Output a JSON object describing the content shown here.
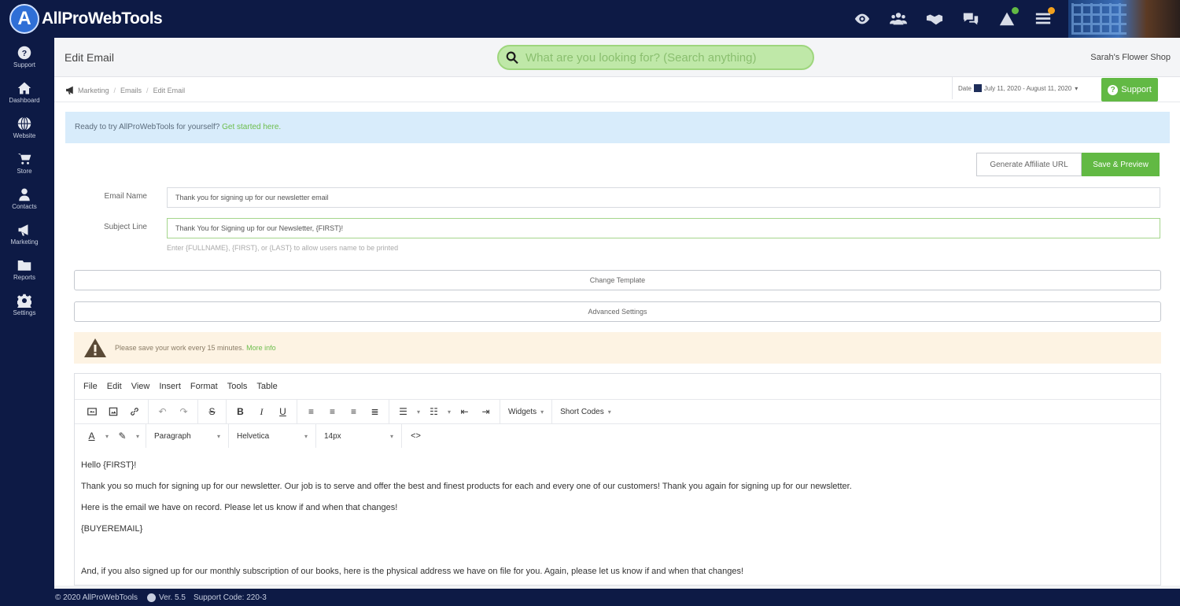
{
  "app": {
    "logo_letter": "A",
    "name": "AllProWebTools"
  },
  "topbar_icons": [
    {
      "icon": "eye-icon"
    },
    {
      "icon": "users-group-icon"
    },
    {
      "icon": "handshake-icon"
    },
    {
      "icon": "chat-icon"
    },
    {
      "icon": "alerts-icon",
      "badge_color": "#62b944"
    },
    {
      "icon": "tasks-icon",
      "badge_color": "#f2a01c"
    }
  ],
  "sidebar": {
    "items": [
      {
        "label": "Support",
        "icon": "question-icon"
      },
      {
        "label": "Dashboard",
        "icon": "home-icon"
      },
      {
        "label": "Website",
        "icon": "globe-icon"
      },
      {
        "label": "Store",
        "icon": "cart-icon"
      },
      {
        "label": "Contacts",
        "icon": "person-icon"
      },
      {
        "label": "Marketing",
        "icon": "megaphone-icon"
      },
      {
        "label": "Reports",
        "icon": "folder-icon"
      },
      {
        "label": "Settings",
        "icon": "gear-icon"
      }
    ]
  },
  "header": {
    "title": "Edit Email",
    "search_placeholder": "What are you looking for? (Search anything)",
    "shop_name": "Sarah's Flower Shop"
  },
  "breadcrumb": [
    "Marketing",
    "Emails",
    "Edit Email"
  ],
  "date_filter": {
    "label": "Date",
    "range": "July 11, 2020 - August 11, 2020"
  },
  "support_button": "Support",
  "banner": {
    "text": "Ready to try AllProWebTools for yourself?",
    "link": "Get started here."
  },
  "buttons": {
    "affiliate": "Generate Affiliate URL",
    "save_preview": "Save & Preview"
  },
  "form": {
    "email_name_label": "Email Name",
    "email_name_value": "Thank you for signing up for our newsletter email",
    "subject_label": "Subject Line",
    "subject_value": "Thank You for Signing up for our Newsletter, {FIRST}!",
    "hint": "Enter {FULLNAME}, {FIRST}, or {LAST} to allow users name to be printed"
  },
  "change_template": "Change Template",
  "advanced_settings": "Advanced Settings",
  "warning": {
    "text": "Please save your work every 15 minutes.",
    "link": "More info"
  },
  "editor": {
    "menu": [
      "File",
      "Edit",
      "View",
      "Insert",
      "Format",
      "Tools",
      "Table"
    ],
    "widgets": "Widgets",
    "short_codes": "Short Codes",
    "block_format": "Paragraph",
    "font_family": "Helvetica",
    "font_size": "14px",
    "content": [
      "Hello {FIRST}!",
      "Thank you so much for signing up for our newsletter. Our job is to serve and offer the best and finest products for each and every one of our customers! Thank you again for signing up for our newsletter.",
      "Here is the email we have on record. Please let us know if and when that changes!",
      "{BUYEREMAIL}",
      "",
      "And, if you also signed up for our monthly subscription of our books, here is the physical address we have on file for you. Again, please let us know if and when that changes!"
    ]
  },
  "footer": {
    "copyright": "© 2020 AllProWebTools",
    "version": "Ver. 5.5",
    "support_code": "Support Code: 220-3"
  }
}
